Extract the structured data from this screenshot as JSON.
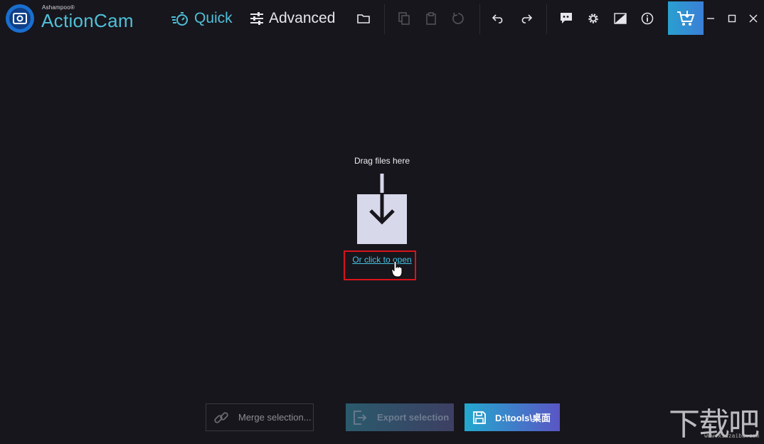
{
  "app": {
    "brand_small": "Ashampoo®",
    "brand_name": "ActionCam"
  },
  "toolbar": {
    "quick_label": "Quick",
    "advanced_label": "Advanced"
  },
  "dropzone": {
    "title": "Drag files here",
    "open_link": "Or click to open"
  },
  "bottom": {
    "merge_label": "Merge selection...",
    "export_label": "Export selection",
    "save_path": "D:\\tools\\桌面"
  },
  "watermark": {
    "text": "下载吧",
    "url": "www.xiazaiba.com"
  },
  "colors": {
    "background": "#17161c",
    "accent": "#4fc0d9",
    "highlight": "#d8141b"
  }
}
